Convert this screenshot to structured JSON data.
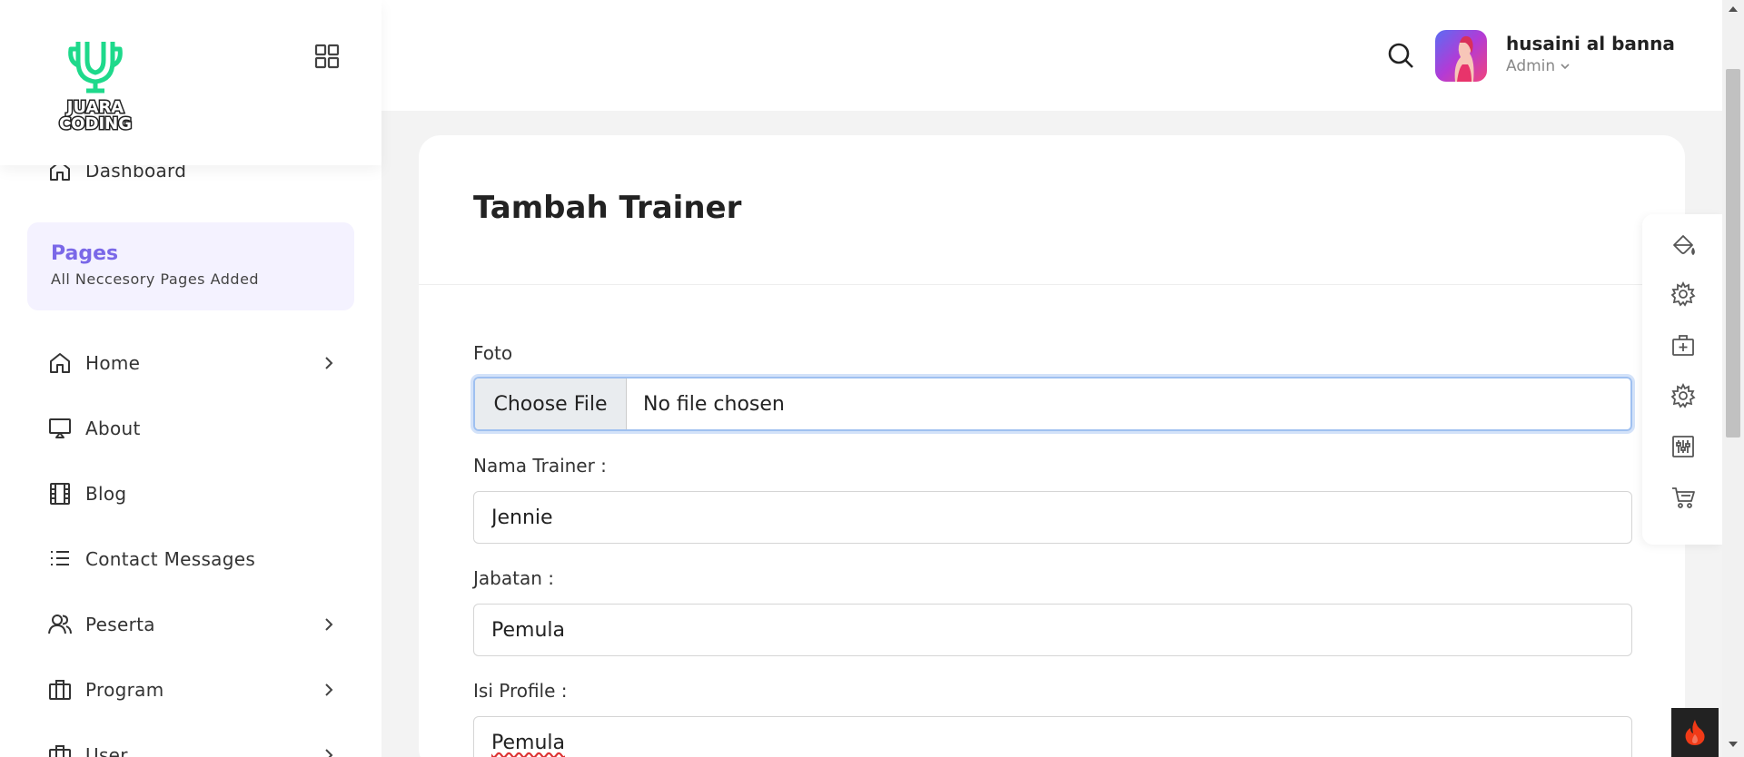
{
  "brand": {
    "logo_line1": "JUARA",
    "logo_line2": "CODING",
    "accent": "#1ed98b"
  },
  "header": {
    "user_name": "husaini al banna",
    "user_role": "Admin"
  },
  "sidebar": {
    "dashboard_label": "Dashboard",
    "pages_card": {
      "title": "Pages",
      "subtitle": "All Neccesory Pages Added"
    },
    "items": [
      {
        "label": "Home",
        "icon": "home-icon",
        "has_submenu": true
      },
      {
        "label": "About",
        "icon": "monitor-icon",
        "has_submenu": false
      },
      {
        "label": "Blog",
        "icon": "film-icon",
        "has_submenu": false
      },
      {
        "label": "Contact Messages",
        "icon": "list-icon",
        "has_submenu": false
      },
      {
        "label": "Peserta",
        "icon": "users-icon",
        "has_submenu": true
      },
      {
        "label": "Program",
        "icon": "briefcase-icon",
        "has_submenu": true
      },
      {
        "label": "User",
        "icon": "briefcase-icon",
        "has_submenu": true
      }
    ]
  },
  "form": {
    "title": "Tambah Trainer",
    "foto_label": "Foto",
    "file_button": "Choose File",
    "file_status": "No file chosen",
    "nama_label": "Nama Trainer :",
    "nama_value": "Jennie",
    "jabatan_label": "Jabatan :",
    "jabatan_value": "Pemula",
    "profile_label": "Isi Profile :",
    "profile_value": "Pemula"
  },
  "float_panel": {
    "icons": [
      "paint-bucket-icon",
      "settings-icon",
      "medical-bag-icon",
      "settings-icon",
      "sliders-icon",
      "cart-icon"
    ]
  },
  "colors": {
    "primary": "#7a68e8",
    "pages_bg": "#f4f2ff",
    "focus": "#9fc0f0"
  }
}
